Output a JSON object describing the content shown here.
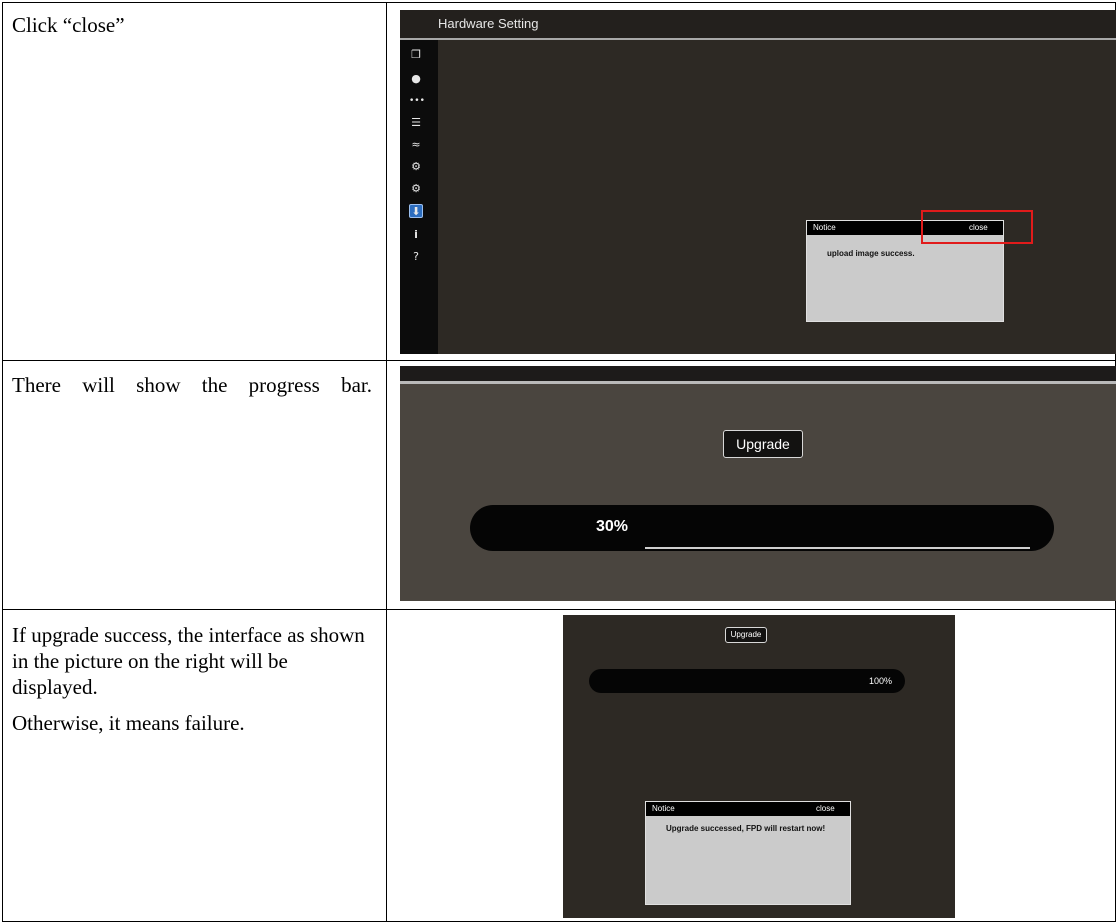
{
  "rows": [
    {
      "instruction": [
        "Click “close”"
      ],
      "screenshot": {
        "window_title": "Hardware Setting",
        "sidebar_icons": [
          "copy-icon",
          "record-icon",
          "more-icon",
          "list-icon",
          "wifi-icon",
          "satellite-icon",
          "gear-icon",
          "download-icon",
          "info-icon",
          "help-icon"
        ],
        "sidebar_glyphs": [
          "❐",
          "●",
          "•••",
          "☰",
          "≈",
          "⚙",
          "⚙",
          "⬇",
          "i",
          "?"
        ],
        "selected_icon": "download-icon",
        "notice": {
          "title": "Notice",
          "close": "close",
          "message": "upload image success."
        },
        "highlight_color": "#e11b1b"
      }
    },
    {
      "instruction": [
        "There will show the progress bar."
      ],
      "screenshot": {
        "button_label": "Upgrade",
        "progress_label": "30%",
        "progress_value": 0.3
      }
    },
    {
      "instruction": [
        "If upgrade success, the interface as shown in the picture on the right will be displayed.",
        "Otherwise, it means failure."
      ],
      "screenshot": {
        "button_label": "Upgrade",
        "progress_label": "100%",
        "progress_value": 1.0,
        "notice": {
          "title": "Notice",
          "close": "close",
          "message": "Upgrade successed, FPD will restart now!"
        }
      }
    }
  ]
}
